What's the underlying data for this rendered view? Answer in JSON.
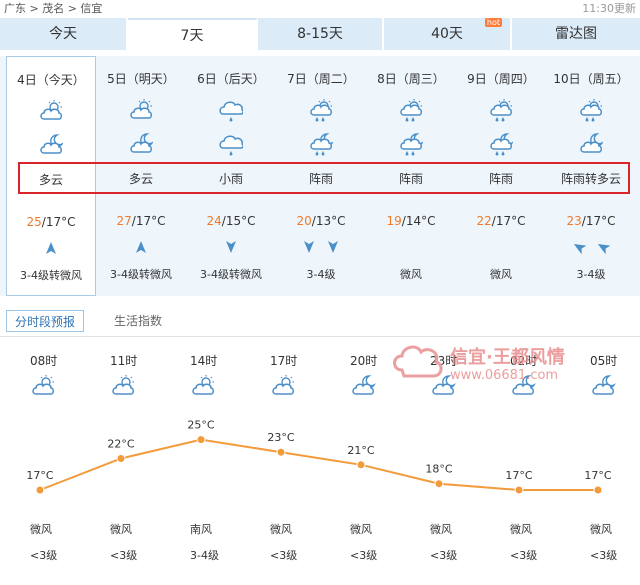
{
  "header": {
    "breadcrumb": "广东 > 茂名 > 信宜",
    "updated": "11:30更新"
  },
  "tabs": [
    {
      "label": "今天"
    },
    {
      "label": "7天",
      "active": true
    },
    {
      "label": "8-15天"
    },
    {
      "label": "40天",
      "badge": "hot"
    },
    {
      "label": "雷达图"
    }
  ],
  "days": [
    {
      "label": "4日（今天）",
      "icon_day": "partly-cloudy-icon",
      "icon_night": "partly-cloudy-night-icon",
      "condition": "多云",
      "high": "25",
      "low": "/17°C",
      "wind_dirs": [
        "north-wind-icon"
      ],
      "wind_level": "3-4级转微风"
    },
    {
      "label": "5日（明天）",
      "icon_day": "partly-cloudy-icon",
      "icon_night": "partly-cloudy-night-icon",
      "condition": "多云",
      "high": "27",
      "low": "/17°C",
      "wind_dirs": [
        "north-wind-icon"
      ],
      "wind_level": "3-4级转微风"
    },
    {
      "label": "6日（后天）",
      "icon_day": "light-rain-icon",
      "icon_night": "light-rain-icon",
      "condition": "小雨",
      "high": "24",
      "low": "/15°C",
      "wind_dirs": [
        "south-wind-icon"
      ],
      "wind_level": "3-4级转微风"
    },
    {
      "label": "7日（周二）",
      "icon_day": "shower-icon",
      "icon_night": "shower-night-icon",
      "condition": "阵雨",
      "high": "20",
      "low": "/13°C",
      "wind_dirs": [
        "south-wind-icon",
        "south-wind-icon"
      ],
      "wind_level": "3-4级"
    },
    {
      "label": "8日（周三）",
      "icon_day": "shower-icon",
      "icon_night": "shower-night-icon",
      "condition": "阵雨",
      "high": "19",
      "low": "/14°C",
      "wind_dirs": [],
      "wind_level": "微风"
    },
    {
      "label": "9日（周四）",
      "icon_day": "shower-icon",
      "icon_night": "shower-night-icon",
      "condition": "阵雨",
      "high": "22",
      "low": "/17°C",
      "wind_dirs": [],
      "wind_level": "微风"
    },
    {
      "label": "10日（周五）",
      "icon_day": "shower-icon",
      "icon_night": "partly-cloudy-night-icon",
      "condition": "阵雨转多云",
      "high": "23",
      "low": "/17°C",
      "wind_dirs": [
        "southeast-wind-icon",
        "southeast-wind-icon"
      ],
      "wind_level": "3-4级"
    }
  ],
  "subtabs": [
    {
      "label": "分时段预报",
      "active": true
    },
    {
      "label": "生活指数"
    }
  ],
  "hourly": [
    {
      "time": "08时",
      "icon": "partly-cloudy-icon",
      "wind": "微风",
      "level": "<3级"
    },
    {
      "time": "11时",
      "icon": "partly-cloudy-icon",
      "wind": "微风",
      "level": "<3级"
    },
    {
      "time": "14时",
      "icon": "partly-cloudy-icon",
      "wind": "南风",
      "level": "3-4级"
    },
    {
      "time": "17时",
      "icon": "partly-cloudy-icon",
      "wind": "微风",
      "level": "<3级"
    },
    {
      "time": "20时",
      "icon": "partly-cloudy-night-icon",
      "wind": "微风",
      "level": "<3级"
    },
    {
      "time": "23时",
      "icon": "partly-cloudy-night-icon",
      "wind": "微风",
      "level": "<3级"
    },
    {
      "time": "02时",
      "icon": "partly-cloudy-night-icon",
      "wind": "微风",
      "level": "<3级"
    },
    {
      "time": "05时",
      "icon": "partly-cloudy-night-icon",
      "wind": "微风",
      "level": "<3级"
    }
  ],
  "chart_data": {
    "type": "line",
    "x": [
      "08时",
      "11时",
      "14时",
      "17时",
      "20时",
      "23时",
      "02时",
      "05时"
    ],
    "values": [
      17,
      22,
      25,
      23,
      21,
      18,
      17,
      17
    ],
    "value_labels": [
      "17°C",
      "22°C",
      "25°C",
      "23°C",
      "21°C",
      "18°C",
      "17°C",
      "17°C"
    ],
    "color": "#f39a3a"
  },
  "watermark": {
    "title": "信宜·王都风情",
    "url": "www.06681.com"
  },
  "colors": {
    "accent": "#2e74b5",
    "high_temp": "#f07a2a",
    "highlight_box": "#d9242a",
    "tab_bg": "#dcebf8",
    "day_bg": "#eef6fc",
    "icon_blue": "#4b8fc9"
  }
}
